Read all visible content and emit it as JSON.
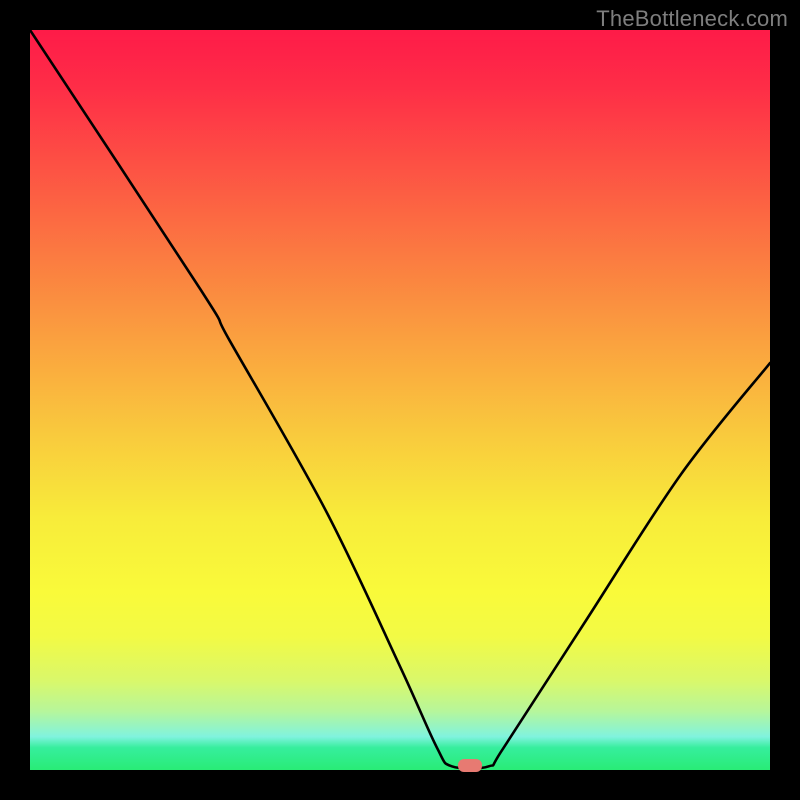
{
  "watermark": {
    "text": "TheBottleneck.com"
  },
  "colors": {
    "frame_bg": "#000000",
    "watermark_text": "#7e7e7e",
    "curve_stroke": "#000000",
    "marker_fill": "#E77A72",
    "gradient_stops": [
      {
        "offset": 0,
        "color": "#FE1B48"
      },
      {
        "offset": 0.08,
        "color": "#FE2E47"
      },
      {
        "offset": 0.18,
        "color": "#FD5044"
      },
      {
        "offset": 0.3,
        "color": "#FB7941"
      },
      {
        "offset": 0.42,
        "color": "#FAA13F"
      },
      {
        "offset": 0.55,
        "color": "#F9CB3D"
      },
      {
        "offset": 0.66,
        "color": "#F8EC3A"
      },
      {
        "offset": 0.76,
        "color": "#F9FA3A"
      },
      {
        "offset": 0.82,
        "color": "#F2FA45"
      },
      {
        "offset": 0.88,
        "color": "#D9F86B"
      },
      {
        "offset": 0.92,
        "color": "#B7F69A"
      },
      {
        "offset": 0.955,
        "color": "#80F3DE"
      },
      {
        "offset": 0.97,
        "color": "#36EE9D"
      },
      {
        "offset": 1.0,
        "color": "#29EC76"
      }
    ]
  },
  "chart_data": {
    "type": "line",
    "title": "",
    "xlabel": "",
    "ylabel": "",
    "xlim": [
      0,
      100
    ],
    "ylim": [
      0,
      100
    ],
    "note": "Axes are 0-100% relative to plot area. (0,0) is bottom-left. Y is bottleneck percentage (high=red, low=green). Minimum near x≈59.",
    "series": [
      {
        "name": "bottleneck-curve",
        "points": [
          {
            "x": 0.0,
            "y": 100.0
          },
          {
            "x": 23.0,
            "y": 65.0
          },
          {
            "x": 27.0,
            "y": 58.0
          },
          {
            "x": 40.0,
            "y": 35.0
          },
          {
            "x": 50.0,
            "y": 14.0
          },
          {
            "x": 55.0,
            "y": 3.0
          },
          {
            "x": 57.0,
            "y": 0.5
          },
          {
            "x": 62.0,
            "y": 0.5
          },
          {
            "x": 64.0,
            "y": 3.0
          },
          {
            "x": 75.0,
            "y": 20.0
          },
          {
            "x": 88.0,
            "y": 40.0
          },
          {
            "x": 100.0,
            "y": 55.0
          }
        ]
      }
    ],
    "marker": {
      "x": 59.5,
      "y": 0.5,
      "label": "optimal-point"
    }
  }
}
